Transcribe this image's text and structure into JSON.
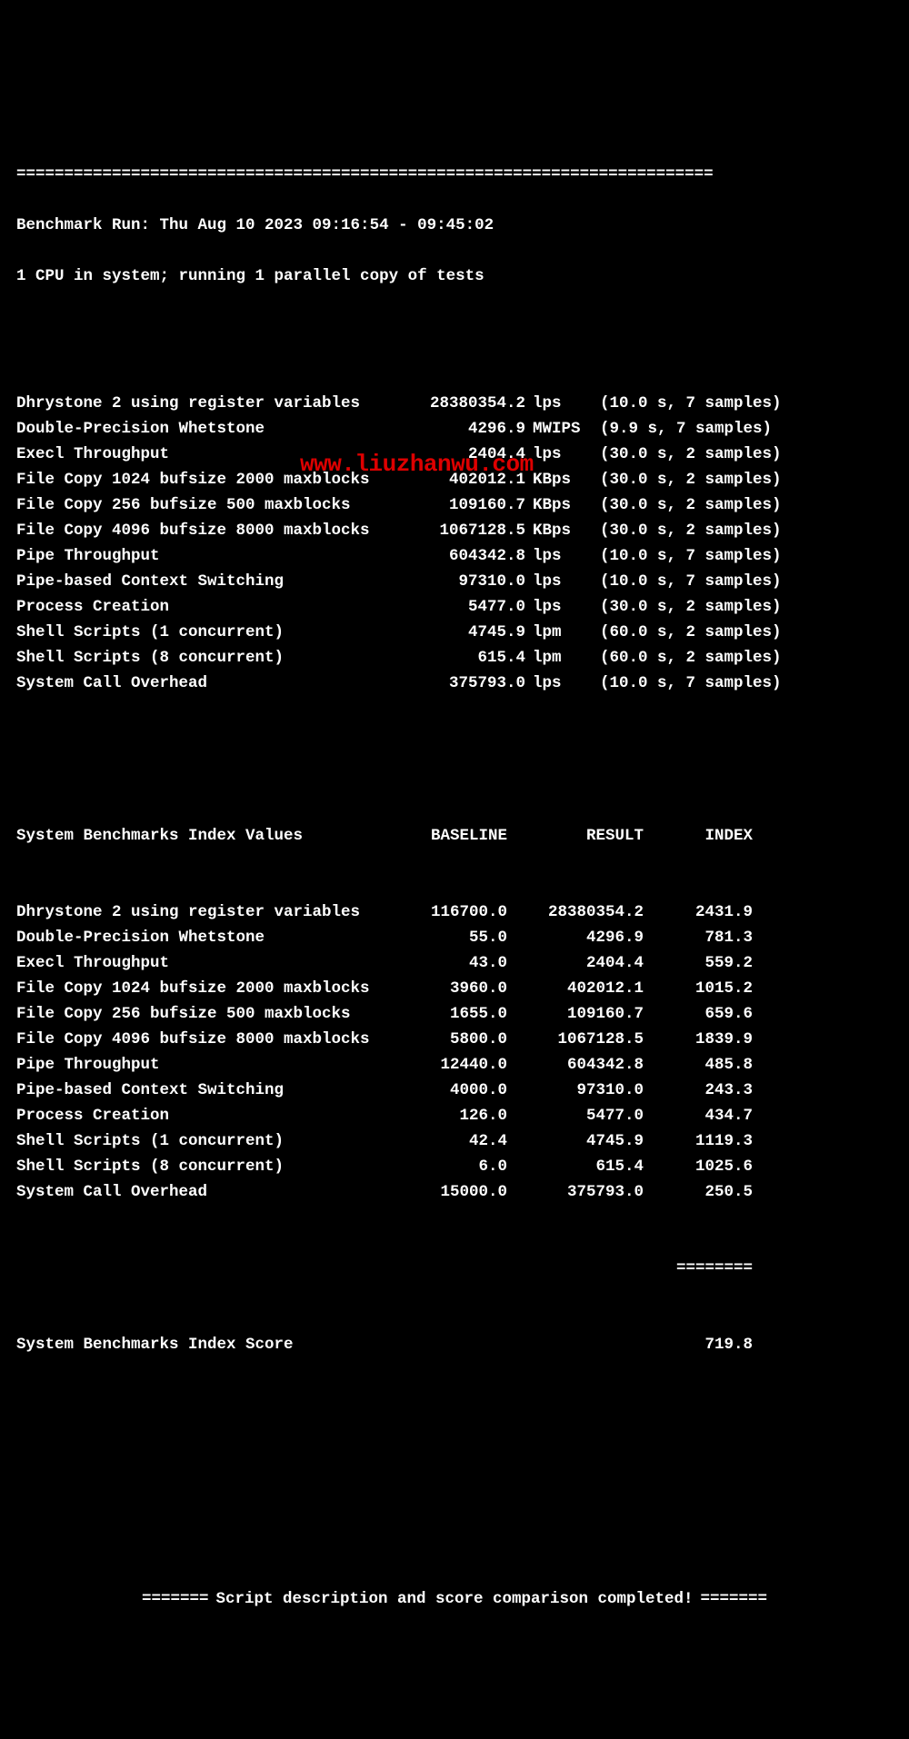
{
  "top_divider": "=========================================================================",
  "run_header": "Benchmark Run: Thu Aug 10 2023 09:16:54 - 09:45:02",
  "system_info": "1 CPU in system; running 1 parallel copy of tests",
  "tests": [
    {
      "name": "Dhrystone 2 using register variables",
      "value": "28380354.2",
      "unit": "lps",
      "params": "(10.0 s, 7 samples)"
    },
    {
      "name": "Double-Precision Whetstone",
      "value": "4296.9",
      "unit": "MWIPS",
      "params": "(9.9 s, 7 samples)"
    },
    {
      "name": "Execl Throughput",
      "value": "2404.4",
      "unit": "lps",
      "params": "(30.0 s, 2 samples)"
    },
    {
      "name": "File Copy 1024 bufsize 2000 maxblocks",
      "value": "402012.1",
      "unit": "KBps",
      "params": "(30.0 s, 2 samples)"
    },
    {
      "name": "File Copy 256 bufsize 500 maxblocks",
      "value": "109160.7",
      "unit": "KBps",
      "params": "(30.0 s, 2 samples)"
    },
    {
      "name": "File Copy 4096 bufsize 8000 maxblocks",
      "value": "1067128.5",
      "unit": "KBps",
      "params": "(30.0 s, 2 samples)"
    },
    {
      "name": "Pipe Throughput",
      "value": "604342.8",
      "unit": "lps",
      "params": "(10.0 s, 7 samples)"
    },
    {
      "name": "Pipe-based Context Switching",
      "value": "97310.0",
      "unit": "lps",
      "params": "(10.0 s, 7 samples)"
    },
    {
      "name": "Process Creation",
      "value": "5477.0",
      "unit": "lps",
      "params": "(30.0 s, 2 samples)"
    },
    {
      "name": "Shell Scripts (1 concurrent)",
      "value": "4745.9",
      "unit": "lpm",
      "params": "(60.0 s, 2 samples)"
    },
    {
      "name": "Shell Scripts (8 concurrent)",
      "value": "615.4",
      "unit": "lpm",
      "params": "(60.0 s, 2 samples)"
    },
    {
      "name": "System Call Overhead",
      "value": "375793.0",
      "unit": "lps",
      "params": "(10.0 s, 7 samples)"
    }
  ],
  "index_header": {
    "name": "System Benchmarks Index Values",
    "baseline": "BASELINE",
    "result": "RESULT",
    "index": "INDEX"
  },
  "index_rows": [
    {
      "name": "Dhrystone 2 using register variables",
      "baseline": "116700.0",
      "result": "28380354.2",
      "index": "2431.9"
    },
    {
      "name": "Double-Precision Whetstone",
      "baseline": "55.0",
      "result": "4296.9",
      "index": "781.3"
    },
    {
      "name": "Execl Throughput",
      "baseline": "43.0",
      "result": "2404.4",
      "index": "559.2"
    },
    {
      "name": "File Copy 1024 bufsize 2000 maxblocks",
      "baseline": "3960.0",
      "result": "402012.1",
      "index": "1015.2"
    },
    {
      "name": "File Copy 256 bufsize 500 maxblocks",
      "baseline": "1655.0",
      "result": "109160.7",
      "index": "659.6"
    },
    {
      "name": "File Copy 4096 bufsize 8000 maxblocks",
      "baseline": "5800.0",
      "result": "1067128.5",
      "index": "1839.9"
    },
    {
      "name": "Pipe Throughput",
      "baseline": "12440.0",
      "result": "604342.8",
      "index": "485.8"
    },
    {
      "name": "Pipe-based Context Switching",
      "baseline": "4000.0",
      "result": "97310.0",
      "index": "243.3"
    },
    {
      "name": "Process Creation",
      "baseline": "126.0",
      "result": "5477.0",
      "index": "434.7"
    },
    {
      "name": "Shell Scripts (1 concurrent)",
      "baseline": "42.4",
      "result": "4745.9",
      "index": "1119.3"
    },
    {
      "name": "Shell Scripts (8 concurrent)",
      "baseline": "6.0",
      "result": "615.4",
      "index": "1025.6"
    },
    {
      "name": "System Call Overhead",
      "baseline": "15000.0",
      "result": "375793.0",
      "index": "250.5"
    }
  ],
  "index_divider": "========",
  "score_label": "System Benchmarks Index Score",
  "score_value": "719.8",
  "footer_eq": "=======",
  "footer_text": "Script description and score comparison completed!",
  "watermark": "www.liuzhanwu.com"
}
